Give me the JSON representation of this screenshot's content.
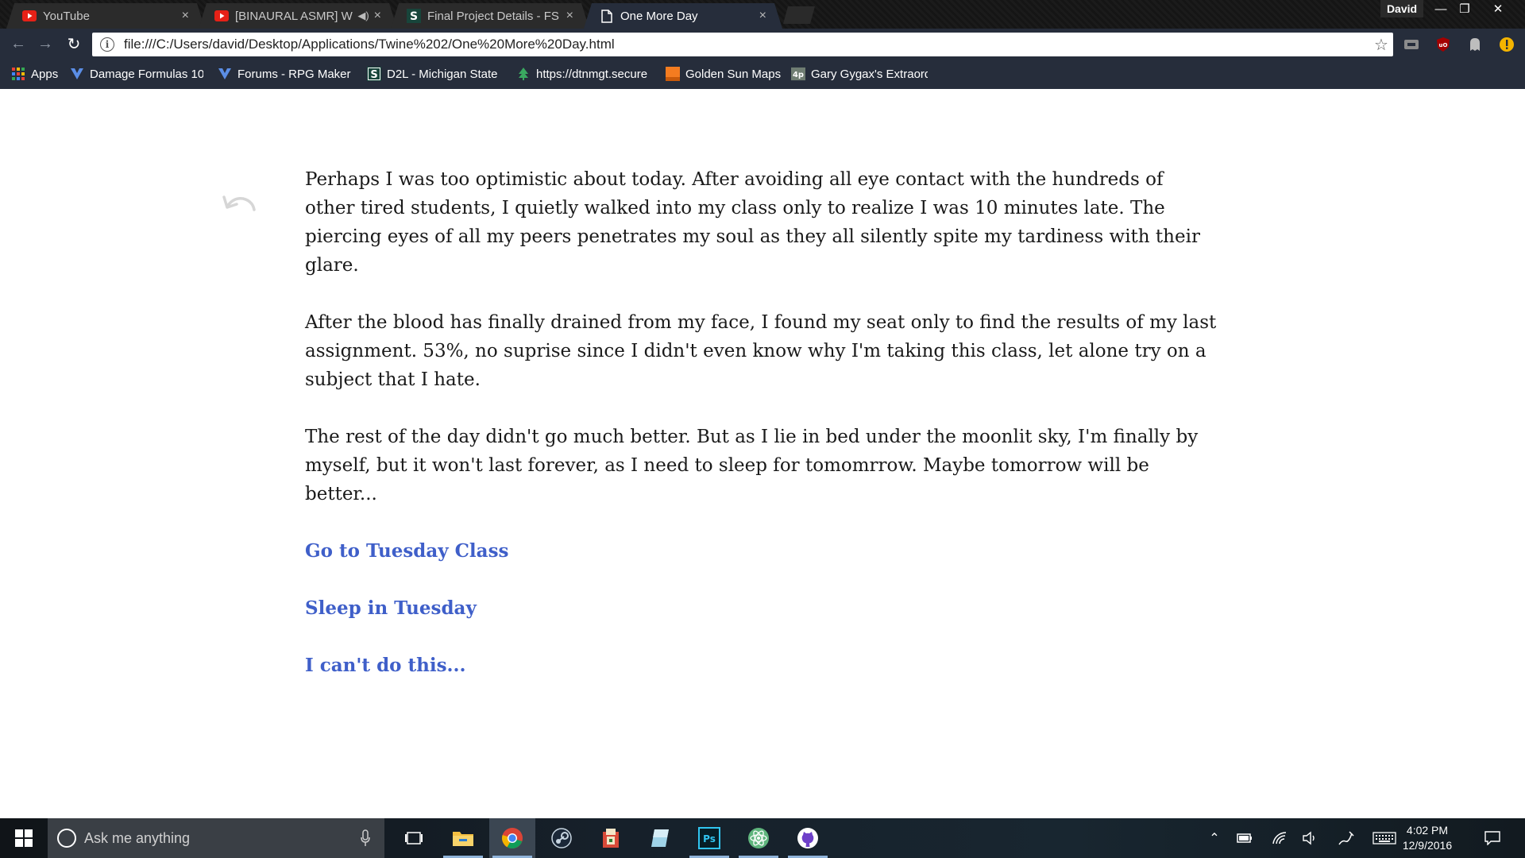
{
  "browser": {
    "tabs": [
      {
        "title": "YouTube",
        "icon": "youtube-icon",
        "active": false
      },
      {
        "title": "[BINAURAL ASMR] W",
        "icon": "youtube-icon",
        "audio": true,
        "active": false
      },
      {
        "title": "Final Project Details - FS",
        "icon": "d2l-icon",
        "active": false
      },
      {
        "title": "One More Day",
        "icon": "page-icon",
        "active": true
      }
    ],
    "profile_name": "David",
    "close_glyph": "×",
    "address_url": "file:///C:/Users/david/Desktop/Applications/Twine%202/One%20More%20Day.html",
    "bookmarks": [
      {
        "label": "Apps",
        "icon": "apps-grid-icon"
      },
      {
        "label": "Damage Formulas 10",
        "icon": "rpgmaker-icon"
      },
      {
        "label": "Forums - RPG Maker",
        "icon": "rpgmaker-icon"
      },
      {
        "label": "D2L - Michigan State",
        "icon": "d2l-icon"
      },
      {
        "label": "https://dtnmgt.secure",
        "icon": "tree-icon"
      },
      {
        "label": "Golden Sun Maps",
        "icon": "orange-square-icon"
      },
      {
        "label": "Gary Gygax's Extraord",
        "icon": "4p-icon"
      }
    ],
    "colors": {
      "chrome": "#262d3b",
      "link": "#3f5fc9"
    }
  },
  "story": {
    "paragraphs": [
      "Perhaps I was too optimistic about today. After avoiding all eye contact with the hundreds of other tired students, I quietly walked into my class only to realize I was 10 minutes late. The piercing eyes of all my peers penetrates my soul as they all silently spite my tardiness with their glare.",
      "After the blood has finally drained from my face, I found my seat only to find the results of my last assignment. 53%, no suprise since I didn't even know why I'm taking this class, let alone try on a subject that I hate.",
      "The rest of the day didn't go much better. But as I lie in bed under the moonlit sky, I'm finally by myself, but it won't last forever, as I need to sleep for tomomrrow. Maybe tomorrow will be better..."
    ],
    "choices": [
      "Go to Tuesday Class",
      "Sleep in Tuesday",
      "I can't do this..."
    ]
  },
  "taskbar": {
    "search_placeholder": "Ask me anything",
    "apps": [
      "task-view-icon",
      "file-explorer-icon",
      "chrome-icon",
      "steam-icon",
      "game-icon",
      "notepad-icon",
      "photoshop-icon",
      "atom-icon",
      "github-icon"
    ],
    "photoshop_label": "Ps",
    "time": "4:02 PM",
    "date": "12/9/2016"
  }
}
